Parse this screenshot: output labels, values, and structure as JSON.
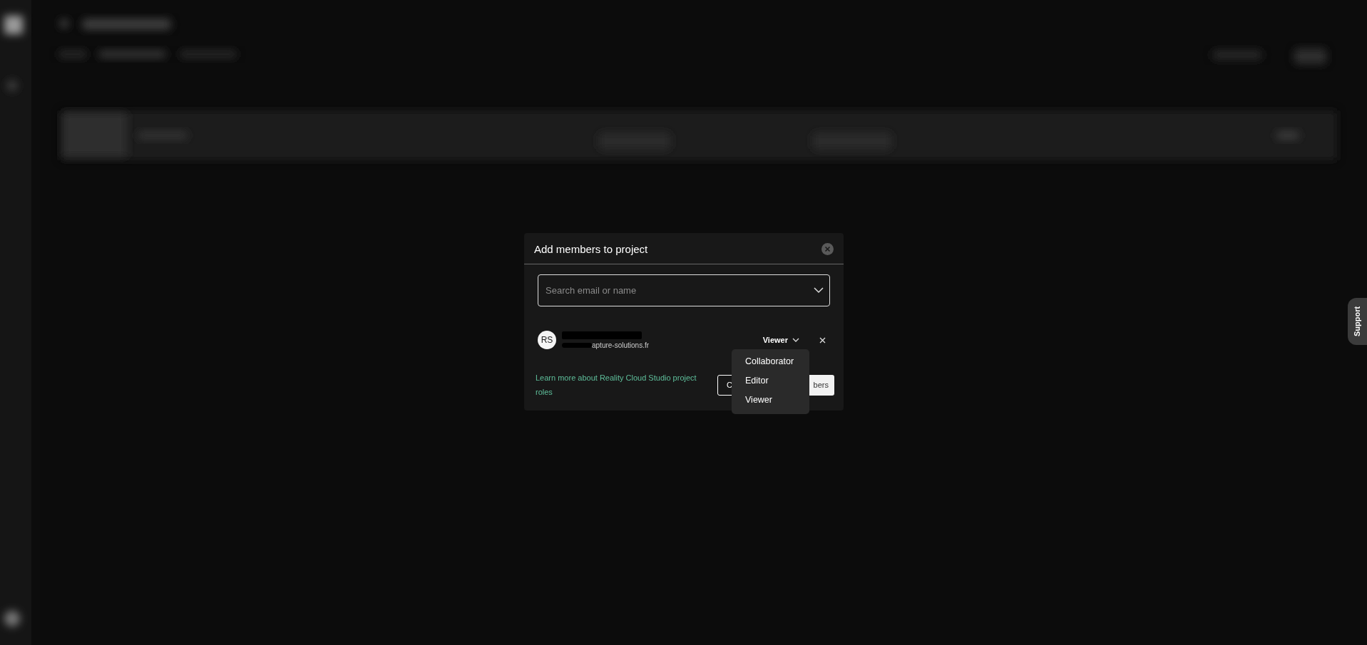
{
  "dialog": {
    "title": "Add members to project",
    "search": {
      "placeholder": "Search email or name"
    },
    "members": [
      {
        "initials": "RS",
        "email": "apture-solutions.fr",
        "role": "Viewer"
      }
    ],
    "learn_more_link": "Learn more about Reality Cloud Studio project roles",
    "buttons": [
      {
        "kind": "outline",
        "label": "C"
      },
      {
        "kind": "solid",
        "label": "bers"
      }
    ]
  },
  "role_menu": {
    "items": [
      "Collaborator",
      "Editor",
      "Viewer"
    ]
  },
  "support_tab": {
    "label": "Support"
  }
}
